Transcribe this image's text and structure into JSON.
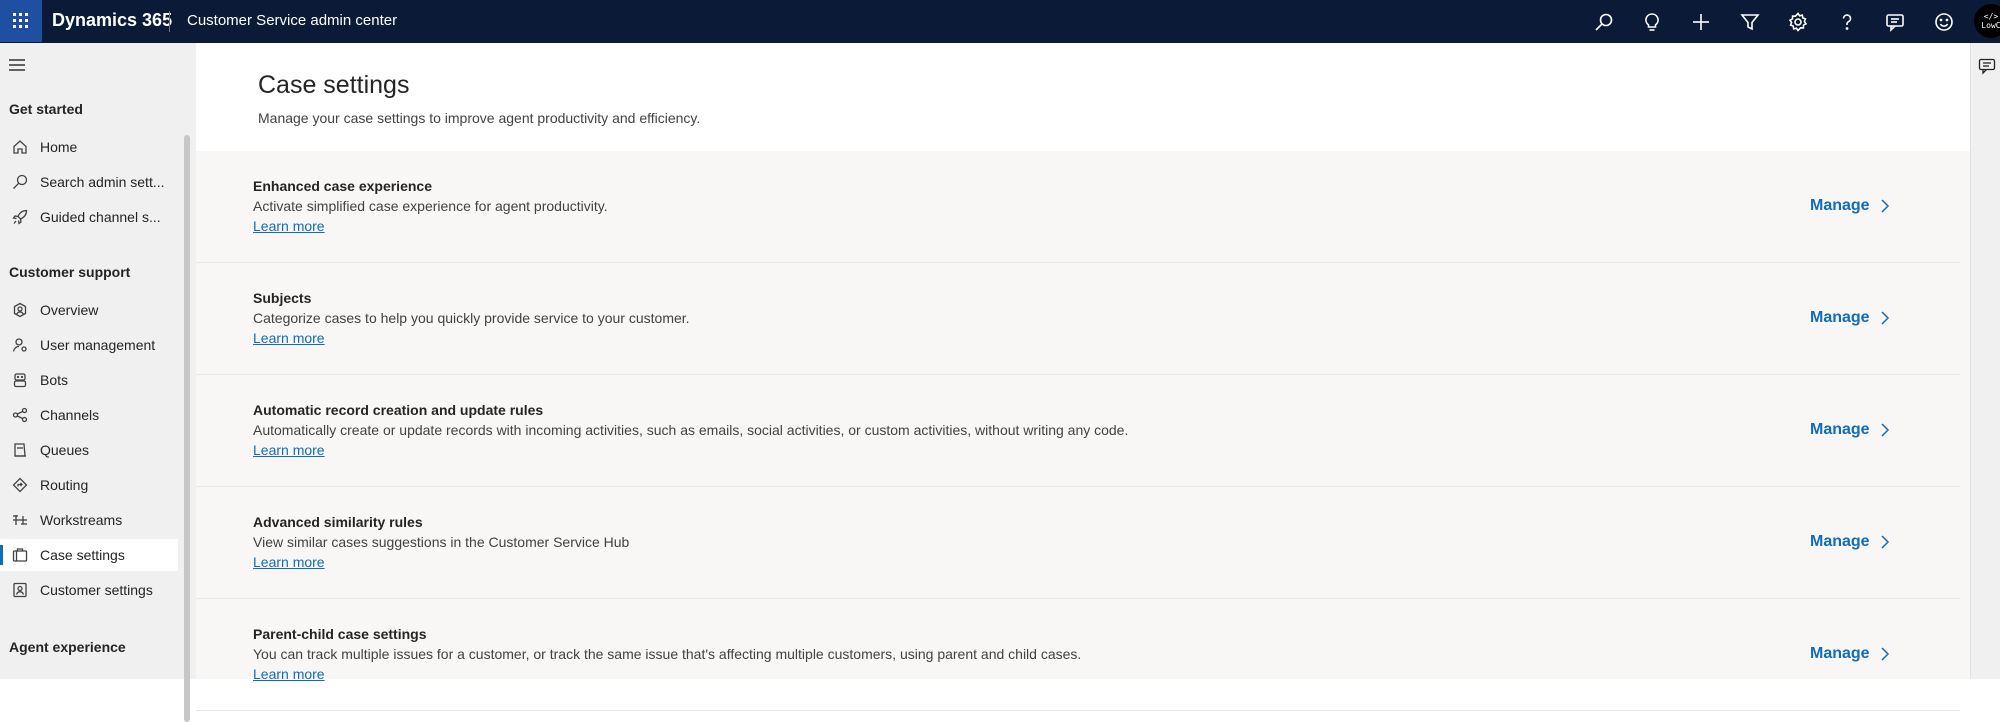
{
  "topbar": {
    "brand": "Dynamics 365",
    "app_name": "Customer Service admin center",
    "avatar_text": "</>\nLowC"
  },
  "sidebar": {
    "sections": [
      {
        "label": "Get started"
      },
      {
        "label": "Customer support"
      },
      {
        "label": "Agent experience"
      }
    ],
    "items": [
      {
        "label": "Home",
        "icon": "home-icon"
      },
      {
        "label": "Search admin sett...",
        "icon": "search-icon"
      },
      {
        "label": "Guided channel s...",
        "icon": "rocket-icon"
      },
      {
        "label": "Overview",
        "icon": "overview-icon"
      },
      {
        "label": "User management",
        "icon": "user-management-icon"
      },
      {
        "label": "Bots",
        "icon": "bot-icon"
      },
      {
        "label": "Channels",
        "icon": "channels-icon"
      },
      {
        "label": "Queues",
        "icon": "queue-icon"
      },
      {
        "label": "Routing",
        "icon": "routing-icon"
      },
      {
        "label": "Workstreams",
        "icon": "workstreams-icon"
      },
      {
        "label": "Case settings",
        "icon": "case-icon",
        "active": true
      },
      {
        "label": "Customer settings",
        "icon": "customer-icon"
      }
    ]
  },
  "page": {
    "title": "Case settings",
    "subtitle": "Manage your case settings to improve agent productivity and efficiency."
  },
  "cards": [
    {
      "title": "Enhanced case experience",
      "description": "Activate simplified case experience for agent productivity.",
      "link": "Learn more",
      "action": "Manage"
    },
    {
      "title": "Subjects",
      "description": "Categorize cases to help you quickly provide service to your customer.",
      "link": "Learn more",
      "action": "Manage"
    },
    {
      "title": "Automatic record creation and update rules",
      "description": "Automatically create or update records with incoming activities, such as emails, social activities, or custom activities, without writing any code.",
      "link": "Learn more",
      "action": "Manage"
    },
    {
      "title": "Advanced similarity rules",
      "description": "View similar cases suggestions in the Customer Service Hub",
      "link": "Learn more",
      "action": "Manage"
    },
    {
      "title": "Parent-child case settings",
      "description": "You can track multiple issues for a customer, or track the same issue that's affecting multiple customers, using parent and child cases.",
      "link": "Learn more",
      "action": "Manage"
    }
  ],
  "colors": {
    "topbar": "#0b1a36",
    "accent": "#0f6cbd",
    "sidebar": "#f0f0f0"
  }
}
